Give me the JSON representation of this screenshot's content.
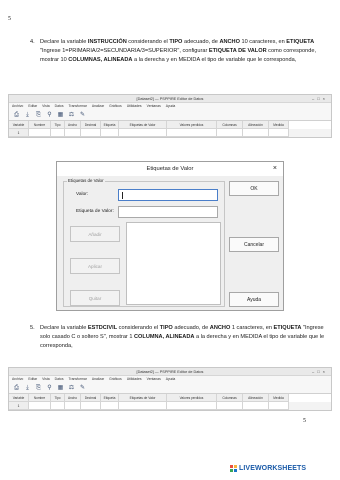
{
  "page_numbers": {
    "top": "5",
    "bottom": "5"
  },
  "item4": {
    "number": "4.",
    "parts": [
      {
        "t": "Declare la variable ",
        "b": false
      },
      {
        "t": "INSTRUCCIÓN",
        "b": true
      },
      {
        "t": " considerando el ",
        "b": false
      },
      {
        "t": "TIPO",
        "b": true
      },
      {
        "t": " adecuado, de ",
        "b": false
      },
      {
        "t": "ANCHO",
        "b": true
      },
      {
        "t": " 10 caracteres, en ",
        "b": false
      },
      {
        "t": "ETIQUETA",
        "b": true
      },
      {
        "t": " \"Ingrese 1=PRIMARIA/2=SECUNDARIA/3=SUPERIOR\", configurar ",
        "b": false
      },
      {
        "t": "ETIQUETA DE VALOR",
        "b": true
      },
      {
        "t": " como corresponde, mostrar 10 ",
        "b": false
      },
      {
        "t": "COLUMNAS, ALINEADA",
        "b": true
      },
      {
        "t": " a la derecha y en MEDIDA el tipo de variable que le corresponda,",
        "b": false
      }
    ]
  },
  "item5": {
    "number": "5.",
    "parts": [
      {
        "t": "Declare la variable ",
        "b": false
      },
      {
        "t": "ESTDCIVIL",
        "b": true
      },
      {
        "t": " considerando el ",
        "b": false
      },
      {
        "t": "TIPO",
        "b": true
      },
      {
        "t": " adecuado, de ",
        "b": false
      },
      {
        "t": "ANCHO",
        "b": true
      },
      {
        "t": " 1 caracteres, en ",
        "b": false
      },
      {
        "t": "ETIQUETA",
        "b": true
      },
      {
        "t": " \"Ingrese solo casado C o soltero S\", mostrar 1 ",
        "b": false
      },
      {
        "t": "COLUMNA, ALINEADA",
        "b": true
      },
      {
        "t": " a la derecha y en MEDIDA el tipo de variable que le corresponda,",
        "b": false
      }
    ]
  },
  "editor": {
    "title": "[Dataset2] — PSPPIRE Editor de Datos",
    "menu": [
      "Archivo",
      "Editar",
      "Vista",
      "Datos",
      "Transformar",
      "Analizar",
      "Gráficos",
      "Utilidades",
      "Ventanas",
      "Ayuda"
    ],
    "columns": [
      "Variable",
      "Nombre",
      "Tipo",
      "Ancho",
      "Decimal",
      "Etiqueta",
      "Etiquetas de Valor",
      "Valores perdidos",
      "Columnas",
      "Alineación",
      "Medida"
    ],
    "row_number": "1"
  },
  "dialog": {
    "title": "Etiquetas de Valor",
    "group_label": "Etiquetas de Valor",
    "value_label": "Valor:",
    "value_text": "",
    "label_label": "Etiqueta de Valor:",
    "label_text": "",
    "add_button": "Añadir",
    "apply_button": "Aplicar",
    "remove_button": "Quitar",
    "ok_button": "OK",
    "cancel_button": "Cancelar",
    "help_button": "Ayuda",
    "close_glyph": "×"
  },
  "brand": {
    "text": "LIVEWORKSHEETS",
    "colors": [
      "#e94e3d",
      "#f7b23b",
      "#3aa655",
      "#1a73c8"
    ]
  }
}
